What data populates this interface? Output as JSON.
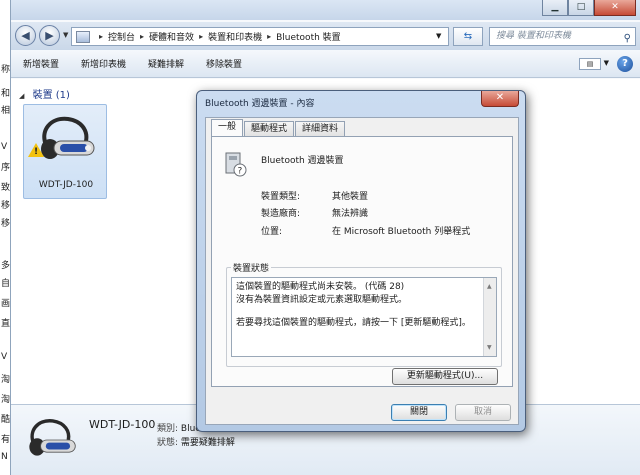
{
  "explorer": {
    "window_buttons": {
      "minimize": "▁",
      "maximize": "□",
      "close": "✕"
    },
    "address": {
      "crumbs": [
        "控制台",
        "硬體和音效",
        "裝置和印表機",
        "Bluetooth 裝置"
      ]
    },
    "search": {
      "placeholder": "搜尋 裝置和印表機"
    },
    "toolbar": {
      "add_device": "新增裝置",
      "add_printer": "新增印表機",
      "troubleshoot": "疑難排解",
      "remove_device": "移除裝置"
    },
    "group": {
      "title": "裝置 (1)"
    },
    "device": {
      "name": "WDT-JD-100"
    },
    "details": {
      "title": "WDT-JD-100",
      "category_label": "類別:",
      "category_value": "Bluetooth",
      "status_label": "狀態:",
      "status_value": "需要疑難排解"
    }
  },
  "background_glyphs": [
    "称",
    "和",
    "相",
    "V",
    "序",
    "致",
    "移",
    "移",
    "多",
    "自",
    "画",
    "直",
    "V",
    "淘",
    "淘",
    "酷",
    "有",
    "N"
  ],
  "dialog": {
    "title": "Bluetooth 週邊裝置 - 內容",
    "close": "✕",
    "tabs": [
      "一般",
      "驅動程式",
      "詳細資料"
    ],
    "device_name": "Bluetooth 週邊裝置",
    "props": [
      {
        "label": "裝置類型:",
        "value": "其他裝置"
      },
      {
        "label": "製造廠商:",
        "value": "無法辨識"
      },
      {
        "label": "位置:",
        "value": "在 Microsoft Bluetooth 列舉程式"
      }
    ],
    "status_group_label": "裝置狀態",
    "status_lines": [
      "這個裝置的驅動程式尚未安裝。 (代碼 28)",
      "沒有為裝置資訊設定或元素選取驅動程式。",
      "若要尋找這個裝置的驅動程式，請按一下 [更新驅動程式]。"
    ],
    "update_driver_button": "更新驅動程式(U)...",
    "close_button": "關閉",
    "cancel_button": "取消"
  }
}
